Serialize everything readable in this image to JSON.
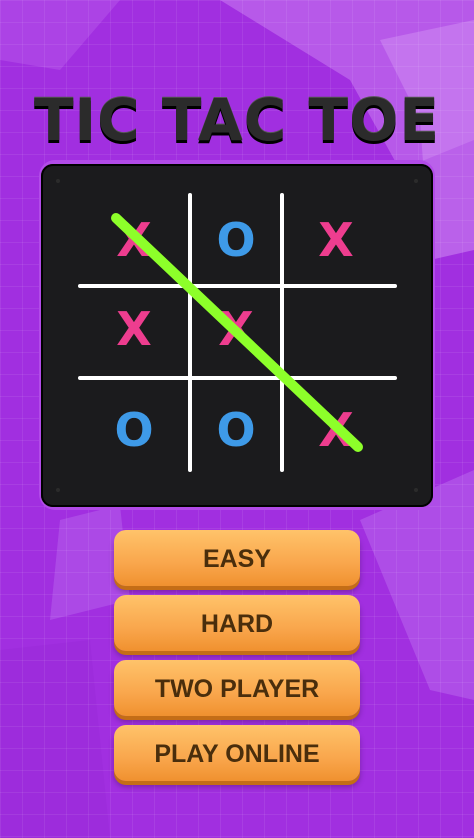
{
  "title": "TIC TAC TOE",
  "board": {
    "cells": [
      [
        "X",
        "O",
        "X"
      ],
      [
        "X",
        "X",
        ""
      ],
      [
        "O",
        "O",
        "X"
      ]
    ],
    "winning_line": "diagonal-top-left-to-bottom-right"
  },
  "menu": {
    "easy": "EASY",
    "hard": "HARD",
    "two_player": "TWO PLAYER",
    "play_online": "PLAY ONLINE"
  },
  "colors": {
    "background": "#a12fe0",
    "x_mark": "#ee3d8f",
    "o_mark": "#3e9ae8",
    "win_line": "#8dff2a",
    "button": "#f9a64c"
  }
}
